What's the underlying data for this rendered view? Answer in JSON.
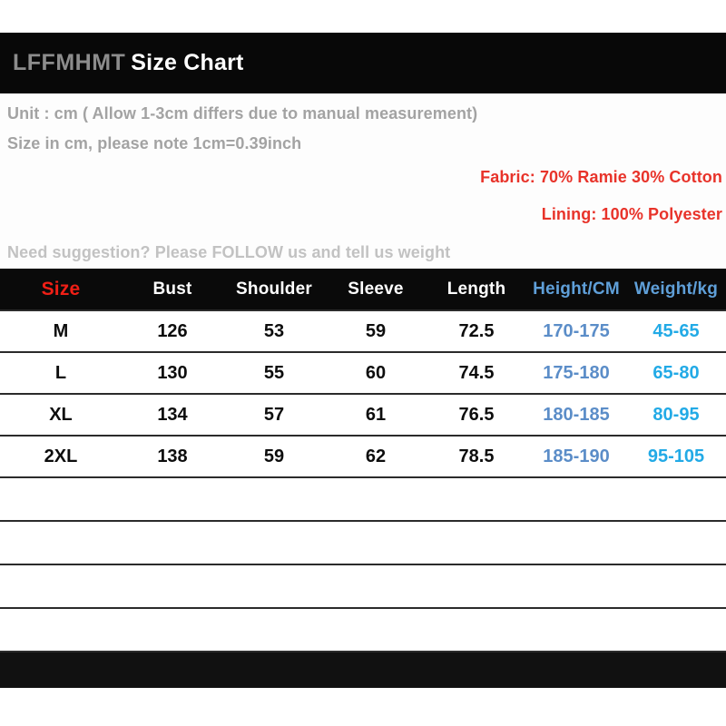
{
  "header": {
    "brand": "LFFMHMT",
    "title": "Size Chart"
  },
  "info": {
    "line1": "Unit : cm ( Allow 1-3cm differs due to manual measurement)",
    "line2": "Size in cm, please note 1cm=0.39inch",
    "fabric": "Fabric: 70% Ramie 30% Cotton",
    "lining": "Lining: 100% Polyester",
    "suggestion": "Need suggestion? Please FOLLOW us and tell us weight"
  },
  "colors": {
    "size_header": "#f01f16",
    "blue_header": "#5f9fd8",
    "height_value": "#5b8dc8",
    "weight_value": "#22aae6",
    "red_text": "#e8332a",
    "gray_text": "#a3a3a3",
    "light_gray_text": "#c2c2c2",
    "band_black": "#080808"
  },
  "table": {
    "columns": [
      "Size",
      "Bust",
      "Shoulder",
      "Sleeve",
      "Length",
      "Height/CM",
      "Weight/kg"
    ],
    "rows": [
      {
        "size": "M",
        "bust": "126",
        "shoulder": "53",
        "sleeve": "59",
        "length": "72.5",
        "height": "170-175",
        "weight": "45-65"
      },
      {
        "size": "L",
        "bust": "130",
        "shoulder": "55",
        "sleeve": "60",
        "length": "74.5",
        "height": "175-180",
        "weight": "65-80"
      },
      {
        "size": "XL",
        "bust": "134",
        "shoulder": "57",
        "sleeve": "61",
        "length": "76.5",
        "height": "180-185",
        "weight": "80-95"
      },
      {
        "size": "2XL",
        "bust": "138",
        "shoulder": "59",
        "sleeve": "62",
        "length": "78.5",
        "height": "185-190",
        "weight": "95-105"
      }
    ],
    "empty_row_count": 4
  }
}
